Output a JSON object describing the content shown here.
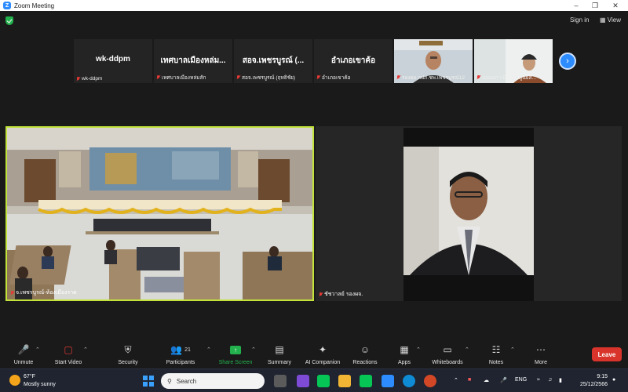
{
  "window": {
    "title": "Zoom Meeting",
    "app_letter": "Z"
  },
  "topbar": {
    "sign_in": "Sign in",
    "view": "View"
  },
  "strip": {
    "tiles": [
      {
        "big": "wk-ddpm",
        "label": "wk-ddpm"
      },
      {
        "big": "เทศบาลเมืองหล่ม...",
        "label": "เทศบาลเมืองหล่มสัก"
      },
      {
        "big": "สอจ.เพชรบูรณ์ (...",
        "label": "สอจ.เพชรบูรณ์ (ฤทธิชัย)"
      },
      {
        "big": "อำเภอเขาค้อ",
        "label": "อำเภอเขาค้อ"
      },
      {
        "big": "",
        "label": "รองผอ.กปภ.ชพ.เพชรบูรณ์12"
      },
      {
        "big": "",
        "label": "ปณณภา บัญญัติ ศูนย์ส..."
      }
    ]
  },
  "videos": {
    "left_label": "จ.เพชรบูรณ์-ห้องเมืองราด",
    "right_label": "ชัชวาลย์ รองผจ."
  },
  "toolbar": {
    "unmute": "Unmute",
    "start_video": "Start Video",
    "security": "Security",
    "participants": "Participants",
    "participants_count": "21",
    "share_screen": "Share Screen",
    "summary": "Summary",
    "ai_companion": "AI Companion",
    "reactions": "Reactions",
    "apps": "Apps",
    "whiteboards": "Whiteboards",
    "notes": "Notes",
    "more": "More",
    "leave": "Leave"
  },
  "taskbar": {
    "weather_temp": "67°F",
    "weather_desc": "Mostly sunny",
    "search_placeholder": "Search",
    "lang": "ENG",
    "time": "9:15",
    "date": "25/12/2566"
  },
  "colors": {
    "accent": "#2d8cff",
    "active_speaker": "#c2e33a",
    "leave": "#d9342b",
    "share": "#23b14d"
  }
}
